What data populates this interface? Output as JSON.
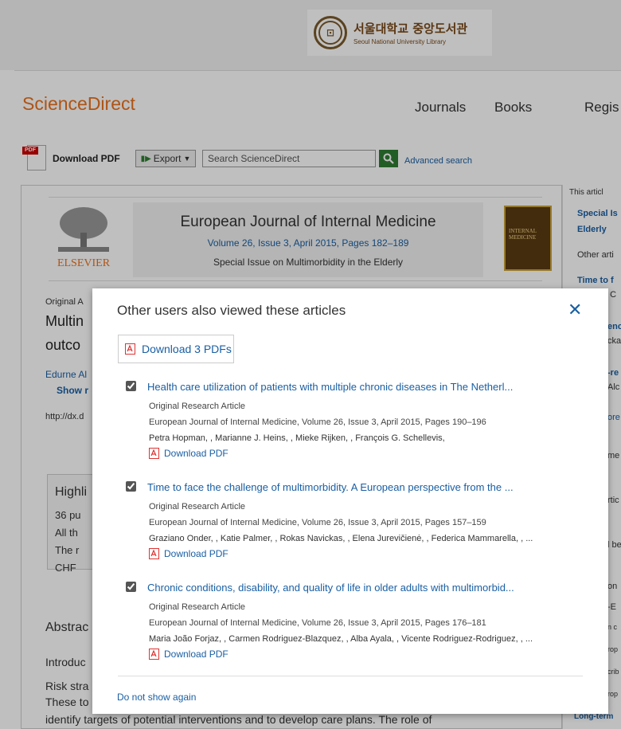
{
  "library": {
    "name_ko": "서울대학교 중앙도서관",
    "name_en": "Seoul National University Library"
  },
  "header": {
    "logo": "ScienceDirect",
    "nav": [
      "Journals",
      "Books",
      "Regis"
    ]
  },
  "toolbar": {
    "download_pdf": "Download PDF",
    "export_label": "Export",
    "search_placeholder": "Search ScienceDirect",
    "advanced_search": "Advanced search"
  },
  "journal": {
    "title": "European Journal of Internal Medicine",
    "volume": "Volume 26, Issue 3, April 2015, Pages 182–189",
    "issue": "Special Issue on Multimorbidity in the Elderly",
    "publisher": "ELSEVIER",
    "cover_text": "INTERNAL MEDICINE"
  },
  "background_fragments": {
    "original": "Original A",
    "title1": "Multin",
    "title2": "outco",
    "authors": "Edurne Al",
    "show": "Show r",
    "doi": "http://dx.d",
    "highlights": "Highli",
    "bullets": [
      "36 pu",
      "All th",
      "The r",
      "CHF"
    ],
    "abstract": "Abstrac",
    "intro": "Introduc",
    "risk": "Risk stra",
    "these": "These to",
    "bottom_line": "identify targets of potential interventions and to develop care plans. The role of"
  },
  "right_column": [
    "This articl",
    "Special Is",
    "Elderly",
    "Other arti",
    "Time to f",
    "o C",
    "enc",
    "cka",
    "-re",
    "Alc",
    "ore",
    "me",
    "rtic",
    "l be",
    "on",
    "-E",
    "n c",
    "rop",
    "crib",
    "rop",
    "Long-term"
  ],
  "modal": {
    "title": "Other users also viewed these articles",
    "close": "✕",
    "download_all": "Download 3 PDFs",
    "do_not_show": "Do not show again",
    "articles": [
      {
        "title": "Health care utilization of patients with multiple chronic diseases in The Netherl...",
        "type": "Original Research Article",
        "source": "European Journal of Internal Medicine, Volume 26, Issue 3, April 2015, Pages 190–196",
        "authors": "Petra Hopman, , Marianne J. Heins, , Mieke Rijken, , François G. Schellevis,",
        "download": "Download PDF"
      },
      {
        "title": "Time to face the challenge of multimorbidity. A European perspective from the ...",
        "type": "Original Research Article",
        "source": "European Journal of Internal Medicine, Volume 26, Issue 3, April 2015, Pages 157–159",
        "authors": "Graziano Onder, , Katie Palmer, , Rokas Navickas, , Elena Jurevičienė, , Federica Mammarella, , ...",
        "download": "Download PDF"
      },
      {
        "title": "Chronic conditions, disability, and quality of life in older adults with multimorbid...",
        "type": "Original Research Article",
        "source": "European Journal of Internal Medicine, Volume 26, Issue 3, April 2015, Pages 176–181",
        "authors": "Maria João Forjaz, , Carmen Rodriguez-Blazquez, , Alba Ayala, , Vicente Rodriguez-Rodriguez, , ...",
        "download": "Download PDF"
      }
    ]
  }
}
